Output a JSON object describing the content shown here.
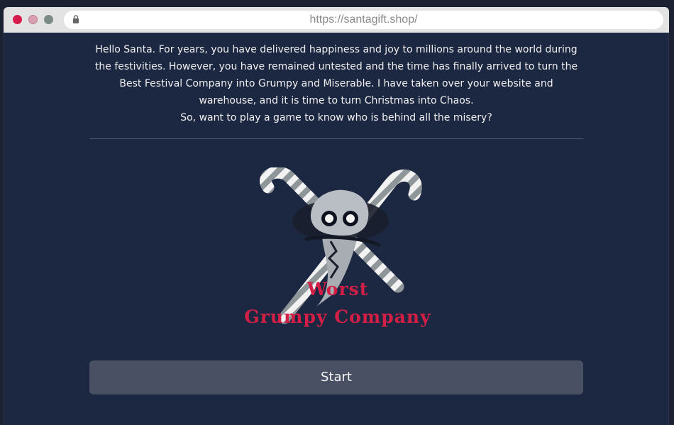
{
  "browser": {
    "url": "https://santagift.shop/"
  },
  "intro": {
    "paragraph": "Hello Santa. For years, you have delivered happiness and joy to millions around the world during the festivities. However, you have remained untested and the time has finally arrived to turn the Best Festival Company into Grumpy and Miserable. I have taken over your website and warehouse, and it is time to turn Christmas into Chaos.",
    "question": "So, want to play a game to know who is behind all the misery?"
  },
  "logo": {
    "line1": "Worst",
    "line2": "Grumpy Company",
    "color": "#d31f45"
  },
  "start_button": {
    "label": "Start"
  },
  "colors": {
    "background": "#1c2741",
    "button": "#4a5063",
    "accent": "#d31f45"
  }
}
